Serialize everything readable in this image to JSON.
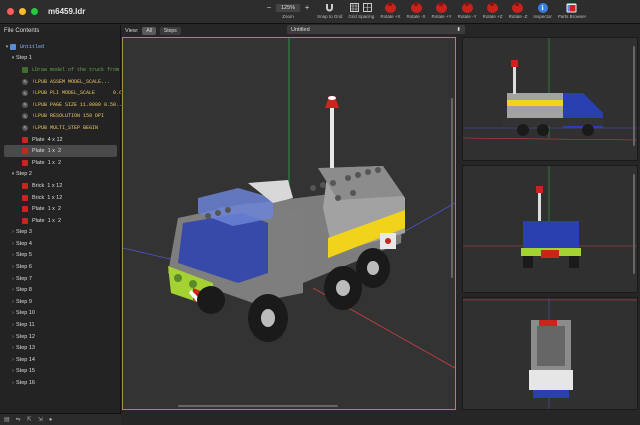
{
  "window": {
    "title": "m6459.ldr"
  },
  "toolbar": {
    "zoom_minus": "−",
    "zoom_value": "125%",
    "zoom_plus": "+",
    "zoom_label": "Zoom",
    "snap_label": "Snap to Grid",
    "grid_label": "Grid Spacing",
    "rot_x_plus": "Rotate +X",
    "rot_x_minus": "Rotate -X",
    "rot_y_plus": "Rotate +Y",
    "rot_y_minus": "Rotate -Y",
    "rot_z_plus": "Rotate +Z",
    "rot_z_minus": "Rotate -Z",
    "inspector_label": "Inspector",
    "parts_label": "Parts Browser"
  },
  "sidebar": {
    "header": "File Contents",
    "model": "Untitled",
    "step1": {
      "label": "Step 1",
      "items": [
        {
          "kind": "comment",
          "text": "LDraw model of the truck from t..."
        },
        {
          "kind": "meta",
          "text": "!LPUB ASSEM MODEL_SCALE..."
        },
        {
          "kind": "meta",
          "text": "!LPUB PLI MODEL_SCALE      0.6"
        },
        {
          "kind": "meta",
          "text": "!LPUB PAGE SIZE 11.0000 8.50..."
        },
        {
          "kind": "meta",
          "text": "!LPUB RESOLUTION 150 DPI"
        },
        {
          "kind": "meta",
          "text": "!LPUB MULTI_STEP BEGIN"
        },
        {
          "kind": "brick",
          "text": "Plate  4 x 12"
        },
        {
          "kind": "brick",
          "text": "Plate  1 x  2",
          "selected": true
        },
        {
          "kind": "brick",
          "text": "Plate  1 x  2"
        }
      ]
    },
    "step2": {
      "label": "Step 2",
      "items": [
        {
          "kind": "brick",
          "text": "Brick  1 x 12"
        },
        {
          "kind": "brick",
          "text": "Brick  1 x 12"
        },
        {
          "kind": "brick",
          "text": "Plate  1 x  2"
        },
        {
          "kind": "brick",
          "text": "Plate  1 x  2"
        }
      ]
    },
    "collapsed_steps": [
      "Step 3",
      "Step 4",
      "Step 5",
      "Step 6",
      "Step 7",
      "Step 8",
      "Step 9",
      "Step 10",
      "Step 11",
      "Step 12",
      "Step 13",
      "Step 14",
      "Step 15",
      "Step 16"
    ]
  },
  "viewbar": {
    "view_label": "View:",
    "all": "All",
    "steps": "Steps",
    "model_select": "Untitled",
    "model_select_arrow": "⬍"
  },
  "colors": {
    "truck_yellow": "#f0d31a",
    "truck_blue": "#2a3fb0",
    "truck_red": "#c9241e",
    "truck_lime": "#a5d233",
    "body_gray": "#9a9a9a"
  }
}
